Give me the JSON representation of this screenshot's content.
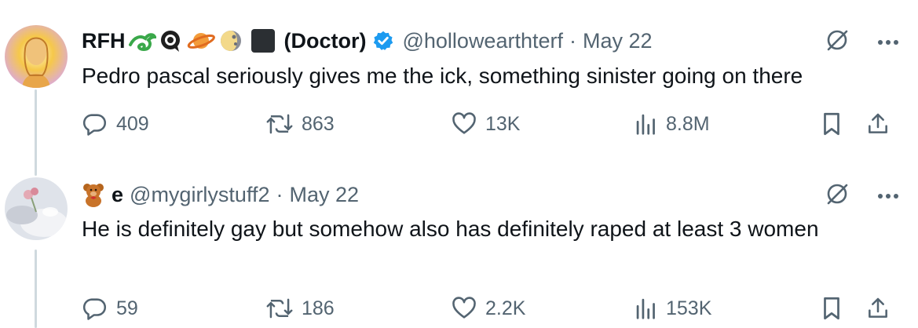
{
  "tweets": [
    {
      "author_name": "RFH",
      "author_suffix": "(Doctor)",
      "name_emojis": [
        "lizard-emoji",
        "eye-in-speech-bubble-emoji",
        "ringed-planet-emoji",
        "moon-phase-emoji",
        "black-square-emoji"
      ],
      "verified": true,
      "handle": "@hollowearthterf",
      "date": "May 22",
      "text": "Pedro pascal seriously gives me the ick, something sinister going on there",
      "replies": "409",
      "retweets": "863",
      "likes": "13K",
      "views": "8.8M"
    },
    {
      "author_name": "e",
      "name_emojis": [
        "teddy-bear-emoji"
      ],
      "verified": false,
      "handle": "@mygirlystuff2",
      "date": "May 22",
      "text": "He is definitely gay but somehow also has definitely raped at least 3 women",
      "replies": "59",
      "retweets": "186",
      "likes": "2.2K",
      "views": "153K"
    }
  ],
  "colors": {
    "text": "#0f1419",
    "secondary": "#536471",
    "verified": "#1d9bf0",
    "thread_line": "#cfd9de"
  }
}
